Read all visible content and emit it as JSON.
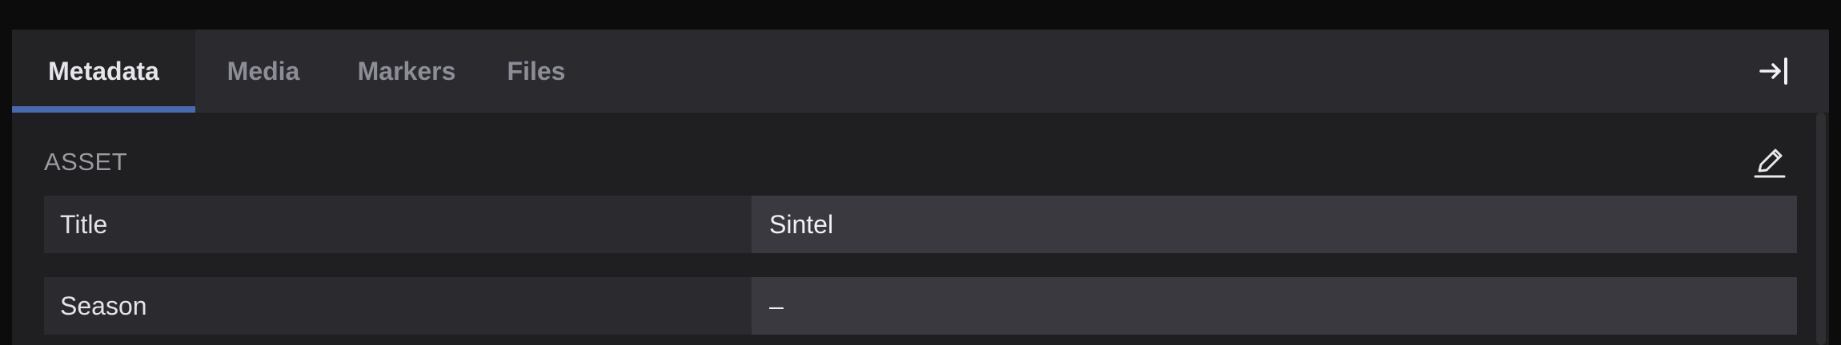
{
  "tabs": [
    {
      "label": "Metadata",
      "active": true
    },
    {
      "label": "Media",
      "active": false
    },
    {
      "label": "Markers",
      "active": false
    },
    {
      "label": "Files",
      "active": false
    }
  ],
  "toolbar": {
    "collapse_icon": "collapse-right-icon"
  },
  "section": {
    "title": "ASSET",
    "edit_icon": "pencil-icon"
  },
  "fields": [
    {
      "label": "Title",
      "value": "Sintel"
    },
    {
      "label": "Season",
      "value": "–"
    }
  ],
  "colors": {
    "accent": "#4a6aae",
    "panel": "#1f1f22",
    "tabbar": "#2b2b2f",
    "label_bg": "#2b2b2f",
    "value_bg": "#39393f"
  }
}
